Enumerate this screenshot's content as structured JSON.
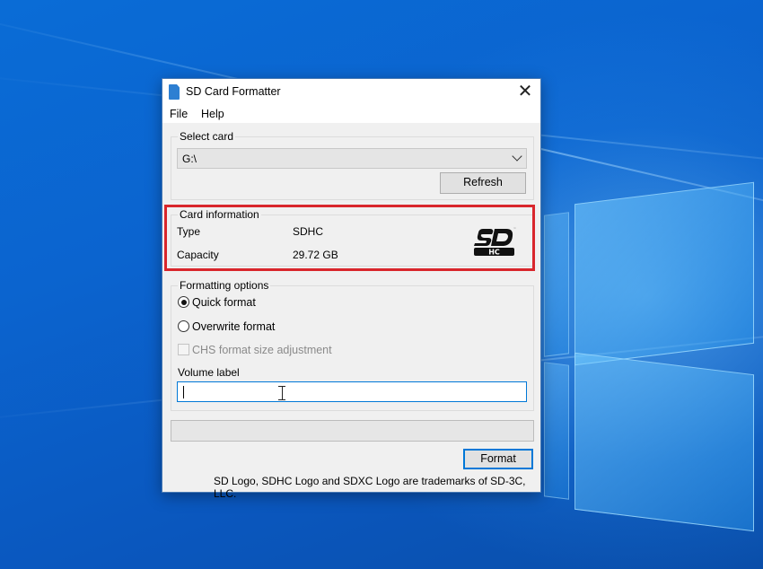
{
  "window": {
    "title": "SD Card Formatter",
    "close_glyph": "✕"
  },
  "menu": {
    "file": "File",
    "help": "Help"
  },
  "select_card": {
    "group_label": "Select card",
    "selected": "G:\\",
    "refresh_label": "Refresh"
  },
  "card_info": {
    "group_label": "Card information",
    "type_label": "Type",
    "type_value": "SDHC",
    "capacity_label": "Capacity",
    "capacity_value": "29.72 GB",
    "logo_icon": "sdhc-logo"
  },
  "formatting": {
    "group_label": "Formatting options",
    "quick_label": "Quick format",
    "quick_checked": true,
    "overwrite_label": "Overwrite format",
    "overwrite_checked": false,
    "chs_label": "CHS format size adjustment",
    "chs_enabled": false,
    "volume_label_caption": "Volume label",
    "volume_value": ""
  },
  "progress": {
    "percent": 0
  },
  "actions": {
    "format_label": "Format"
  },
  "footer": {
    "trademark": "SD Logo, SDHC Logo and SDXC Logo are trademarks of SD-3C, LLC."
  },
  "colors": {
    "highlight": "#d9262c",
    "accent": "#0078d7",
    "desktop": "#0a5fc4"
  }
}
